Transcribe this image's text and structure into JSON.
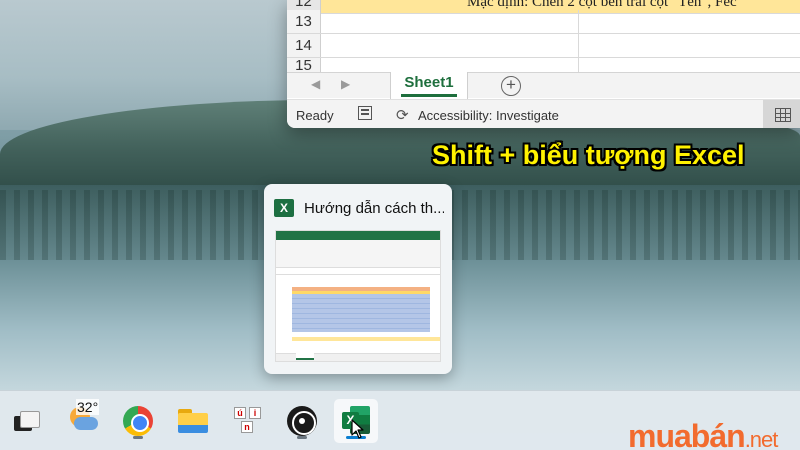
{
  "excel": {
    "row_numbers": [
      "12",
      "13",
      "14",
      "15"
    ],
    "row12_text": "Mặc định: Chèn 2 cột bên trái cột \"Tên\", Fec",
    "sheet_tab": "Sheet1",
    "add_sheet_label": "+",
    "status_ready": "Ready",
    "status_accessibility": "Accessibility: Investigate"
  },
  "caption": "Shift + biểu tượng Excel",
  "preview": {
    "app_icon_letter": "X",
    "title": "Hướng dẫn cách th..."
  },
  "taskbar": {
    "weather_temp": "32°",
    "items": [
      {
        "name": "show-desktop",
        "icon": "desktop-icon"
      },
      {
        "name": "weather",
        "icon": "weather-icon"
      },
      {
        "name": "chrome",
        "icon": "chrome-icon"
      },
      {
        "name": "file-explorer",
        "icon": "folder-icon"
      },
      {
        "name": "unikey",
        "icon": "unikey-icon"
      },
      {
        "name": "obs",
        "icon": "obs-icon"
      },
      {
        "name": "excel",
        "icon": "excel-icon",
        "active": true
      }
    ],
    "excel_icon_letter": "X",
    "unikey_letters": [
      "ú",
      "n",
      "i"
    ]
  },
  "watermark": {
    "main": "muabán",
    "suffix": ".net"
  },
  "colors": {
    "excel_green": "#1e6f3d",
    "caption_yellow": "#fff200",
    "row_highlight": "#ffe699",
    "taskbar_active_indicator": "#0b7fd1",
    "watermark_orange": "#f26b2e"
  }
}
